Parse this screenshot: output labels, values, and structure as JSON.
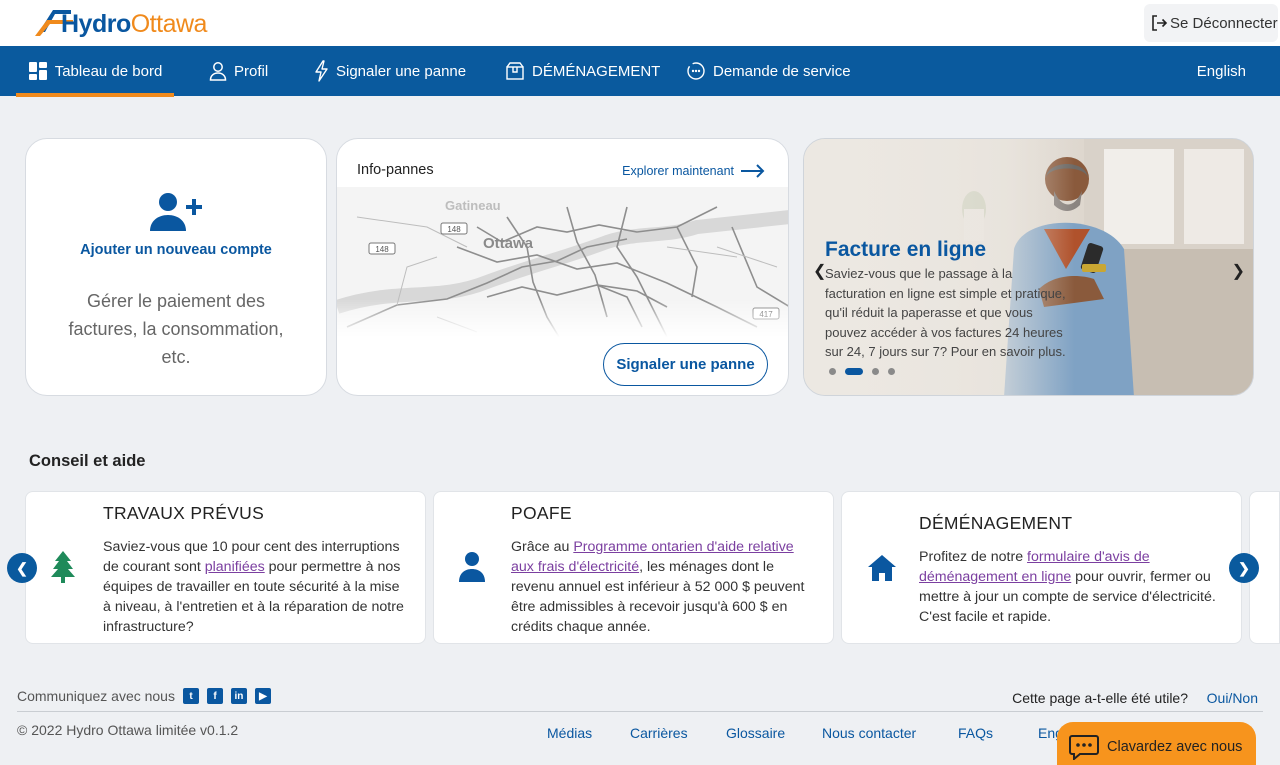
{
  "header": {
    "logo": {
      "part1": "Hydro",
      "part2": "Ottawa"
    },
    "logout_label": "Se Déconnecter"
  },
  "nav": {
    "items": [
      {
        "label": "Tableau de bord",
        "icon": "dashboard-icon"
      },
      {
        "label": "Profil",
        "icon": "user-icon"
      },
      {
        "label": "Signaler une panne",
        "icon": "lightning-icon"
      },
      {
        "label": "DÉMÉNAGEMENT",
        "icon": "box-icon"
      },
      {
        "label": "Demande de service",
        "icon": "service-icon"
      }
    ],
    "language": "English"
  },
  "add_account": {
    "title": "Ajouter un nouveau compte",
    "description": "Gérer le paiement des factures, la consommation, etc."
  },
  "outage_map": {
    "title": "Info-pannes",
    "explore_label": "Explorer maintenant",
    "labels": {
      "city1": "Gatineau",
      "city2": "Ottawa",
      "road1": "148",
      "road2": "148",
      "road3": "417"
    },
    "button": "Signaler une panne"
  },
  "promo": {
    "title": "Facture en ligne",
    "text": "Saviez-vous que le passage à la facturation en ligne est simple et pratique, qu'il réduit la paperasse et que vous pouvez accéder à vos factures 24 heures sur 24, 7 jours sur 7? Pour en savoir plus.",
    "slide_count": 4,
    "active_slide": 1
  },
  "tips": {
    "section_title": "Conseil et aide",
    "items": [
      {
        "title": "TRAVAUX PRÉVUS",
        "icon": "tree-icon",
        "before": "Saviez-vous que 10 pour cent des interruptions de courant sont ",
        "link": "planifiées",
        "after": " pour permettre à nos équipes de travailler en toute sécurité à la mise à niveau, à l'entretien et à la réparation de notre infrastructure?"
      },
      {
        "title": "POAFE",
        "icon": "person-icon",
        "before": "Grâce au ",
        "link": "Programme ontarien d'aide relative aux frais d'électricité",
        "after": ", les ménages dont le revenu annuel est inférieur à 52 000 $ peuvent être admissibles à recevoir jusqu'à 600 $ en crédits chaque année."
      },
      {
        "title": "DÉMÉNAGEMENT",
        "icon": "house-icon",
        "before": "Profitez de notre ",
        "link": "formulaire d'avis de déménagement en ligne",
        "after": " pour ouvrir, fermer ou mettre à jour un compte de service d'électricité. C'est facile et rapide."
      }
    ]
  },
  "footer": {
    "communicate": "Communiquez avec nous",
    "social": [
      {
        "icon": "twitter-icon",
        "glyph": "t"
      },
      {
        "icon": "facebook-icon",
        "glyph": "f"
      },
      {
        "icon": "linkedin-icon",
        "glyph": "in"
      },
      {
        "icon": "youtube-icon",
        "glyph": "▶"
      }
    ],
    "useful_question": "Cette page a-t-elle été utile?",
    "useful_link": "Oui/Non",
    "copyright": "© 2022 Hydro Ottawa limitée v0.1.2",
    "links": [
      "Médias",
      "Carrières",
      "Glossaire",
      "Nous contacter",
      "FAQs",
      "English"
    ],
    "chat_label": "Clavardez avec nous"
  }
}
